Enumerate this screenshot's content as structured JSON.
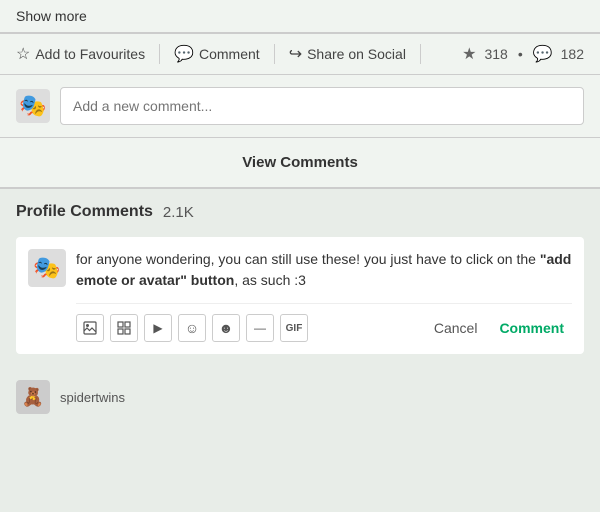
{
  "showmore": {
    "label": "Show more"
  },
  "actionbar": {
    "add_to_favourites": "Add to Favourites",
    "comment": "Comment",
    "share_on_social": "Share on Social",
    "stars_count": "318",
    "comments_count": "182",
    "dot": "•"
  },
  "comment_input": {
    "placeholder": "Add a new comment..."
  },
  "view_comments": {
    "label": "View Comments"
  },
  "profile_comments": {
    "title": "Profile Comments",
    "count": "2.1K"
  },
  "comment": {
    "text_part1": "for anyone wondering, you can still use these! you just have to click on the ",
    "text_bold": "\"add emote or avatar\" button",
    "text_part2": ", as such :3"
  },
  "comment_toolbar": {
    "cancel": "Cancel",
    "submit": "Comment"
  },
  "next_commenter": {
    "username": "spidertwins"
  },
  "icons": {
    "star": "☆",
    "star_filled": "★",
    "comment_bubble": "💬",
    "share": "⤷",
    "image": "🖼",
    "image2": "▦",
    "play": "▶",
    "emoji": "☺",
    "emoji2": "☻",
    "divider": "—",
    "gif": "GIF",
    "avatar1": "🎭",
    "avatar2": "🎭"
  }
}
